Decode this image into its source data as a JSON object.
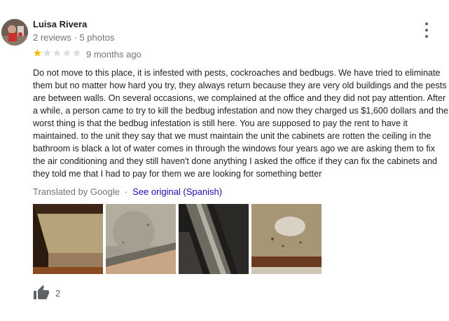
{
  "reviewer": {
    "name": "Luisa Rivera",
    "meta": "2 reviews · 5 photos"
  },
  "rating": {
    "stars": 1,
    "max": 5,
    "filled_color": "#fbbc04",
    "empty_color": "#dadce0"
  },
  "review": {
    "age": "9 months ago",
    "text": "Do not move to this place, it is infested with pests, cockroaches and bedbugs. We have tried to eliminate them but no matter how hard you try, they always return because they are very old buildings and the pests are between walls. On several occasions, we complained at the office and they did not pay attention. After a while, a person came to try to kill the bedbug infestation and now they charged us $1,600 dollars and the worst thing is that the bedbug infestation is still here. You are supposed to pay the rent to have it maintained. to the unit they say that we must maintain the unit the cabinets are rotten the ceiling in the bathroom is black a lot of water comes in through the windows four years ago we are asking them to fix the air conditioning and they still haven't done anything I asked the office if they can fix the cabinets and they told me that I had to pay for them we are looking for something better"
  },
  "translation": {
    "label": "Translated by Google",
    "separator": "·",
    "link": "See original (Spanish)"
  },
  "photos": [
    {
      "icon": "photo-cabinet-interior"
    },
    {
      "icon": "photo-ceiling-corner"
    },
    {
      "icon": "photo-window-track"
    },
    {
      "icon": "photo-shelf-debris"
    }
  ],
  "likes": {
    "count": "2",
    "icon": "thumbs-up-icon"
  },
  "colors": {
    "text": "#202124",
    "secondary": "#70757a",
    "link": "#1a0dab"
  }
}
